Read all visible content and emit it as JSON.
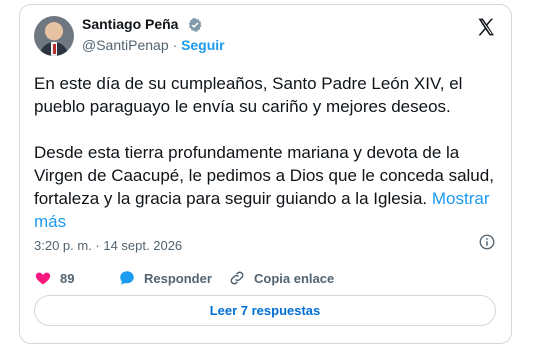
{
  "tweet": {
    "author_name": "Santiago Peña",
    "handle": "@SantiPenap",
    "separator": "·",
    "follow_label": "Seguir",
    "text_para1": "En este día de su cumpleaños, Santo Padre León XIV, el pueblo paraguayo le envía su cariño y mejores deseos.",
    "text_para2": "Desde esta tierra profundamente mariana y devota de la Virgen de Caacupé, le pedimos a Dios que le conceda salud, fortaleza y la gracia para seguir guiando a la Iglesia.",
    "show_more": "Mostrar más",
    "timestamp": "3:20 p. m. · 14 sept. 2026",
    "likes_count": "89",
    "reply_label": "Responder",
    "copy_link_label": "Copia enlace",
    "read_replies_label": "Leer 7 respuestas"
  },
  "icons": {
    "avatar": "profile-photo",
    "verified": "verified-badge-icon",
    "brand": "x-logo-icon",
    "info": "info-icon",
    "like": "heart-icon",
    "reply": "reply-bubble-icon",
    "link": "link-icon"
  },
  "colors": {
    "accent": "#1d9bf0",
    "like": "#f91880",
    "text": "#0f1419",
    "muted": "#536471",
    "border": "#cfd9de"
  }
}
